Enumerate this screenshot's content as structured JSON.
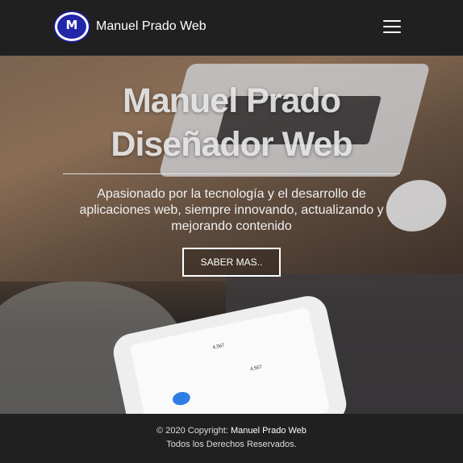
{
  "navbar": {
    "brand": "Manuel Prado Web",
    "logo_text": "M"
  },
  "hero": {
    "title_line1": "Manuel Prado",
    "title_line2": "Diseñador Web",
    "text": "Apasionado por la tecnología y el desarrollo de aplicaciones web, siempre innovando, actualizando y mejorando contenido",
    "button": "SABER MAS..",
    "phone": {
      "value1": "4,567",
      "value2": "4,567"
    }
  },
  "footer": {
    "copyright_prefix": "© 2020 Copyright: ",
    "copyright_link": "Manuel Prado Web",
    "rights": "Todos los Derechos Reservados."
  },
  "colors": {
    "navbar_bg": "#202020",
    "footer_bg": "#202020",
    "text": "#ffffff"
  }
}
